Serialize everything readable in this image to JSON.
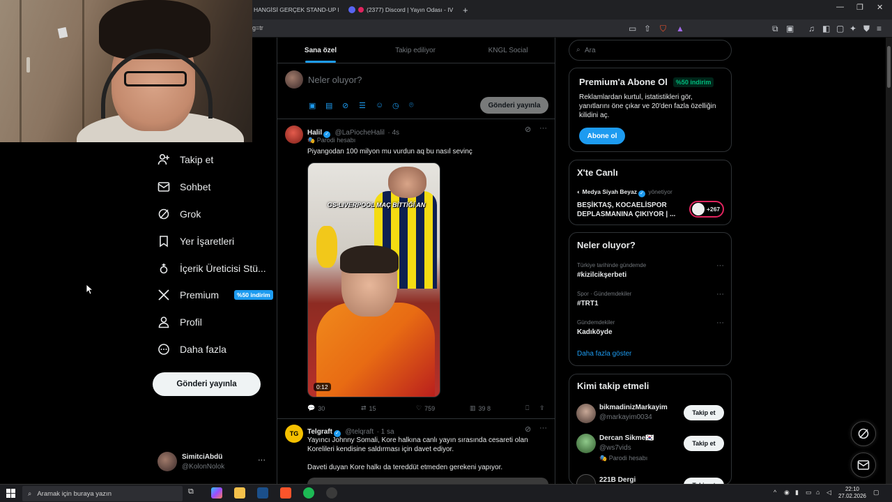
{
  "browser": {
    "tabs": [
      {
        "title": "HANGİSİ GERÇEK STAND-UP KOM"
      },
      {
        "title": "(2377) Discord | Yayın Odası - IV"
      }
    ],
    "new_tab": "+",
    "address": "g=tr",
    "window_buttons": [
      "—",
      "❐",
      "✕"
    ]
  },
  "nav": {
    "items": [
      {
        "label": "Takip et",
        "icon": "person-add-icon"
      },
      {
        "label": "Sohbet",
        "icon": "mail-icon"
      },
      {
        "label": "Grok",
        "icon": "grok-icon"
      },
      {
        "label": "Yer İşaretleri",
        "icon": "bookmark-icon"
      },
      {
        "label": "İçerik Üreticisi Stü...",
        "icon": "creator-studio-icon"
      },
      {
        "label": "Premium",
        "icon": "x-logo-icon",
        "badge": "%50 indirim"
      },
      {
        "label": "Profil",
        "icon": "profile-icon"
      },
      {
        "label": "Daha fazla",
        "icon": "more-circle-icon"
      }
    ],
    "post_button": "Gönderi yayınla",
    "account": {
      "name": "SimitciAbdü",
      "handle": "@KolonNolok",
      "more": "···"
    }
  },
  "feed": {
    "tabs": [
      "Sana özel",
      "Takip ediliyor",
      "KNGL Social"
    ],
    "compose_placeholder": "Neler oluyor?",
    "compose_button": "Gönderi yayınla",
    "tweets": [
      {
        "name": "Halil",
        "handle": "@LaPiocheHalil",
        "time": "· 4s",
        "sub": "Parodi hesabı",
        "text": "Piyangodan 100 milyon mu vurdun aq bu nasıl sevinç",
        "media_caption": "GS-LIVERPOOL MAÇ BİTTİĞİ AN",
        "duration": "0:12",
        "replies": "30",
        "reposts": "15",
        "likes": "759",
        "views": "39 8"
      },
      {
        "name": "Telgraft",
        "handle": "@telqraft",
        "time": "· 1 sa",
        "text1": "Yayıncı Johnny Somali, Kore halkına canlı yayın sırasında cesareti olan Korelileri kendisine saldırması için davet ediyor.",
        "text2": "Daveti duyan Kore halkı da tereddüt etmeden gerekeni yapıyor."
      }
    ]
  },
  "sidebar": {
    "search_placeholder": "Ara",
    "premium": {
      "title": "Premium'a Abone Ol",
      "badge": "%50 indirim",
      "text": "Reklamlardan kurtul, istatistikleri gör, yanıtlarını öne çıkar ve 20'den fazla özelliğin kilidini aç.",
      "button": "Abone ol"
    },
    "live": {
      "title": "X'te Canlı",
      "host": "Medya Siyah Beyaz",
      "role": "yönetiyor",
      "text": "BEŞİKTAŞ, KOCAELİSPOR DEPLASMANINA ÇIKIYOR | ...",
      "count": "+267"
    },
    "trends": {
      "title": "Neler oluyor?",
      "items": [
        {
          "meta": "Türkiye tarihinde gündemde",
          "name": "#kizilcikşerbeti"
        },
        {
          "meta": "Spor · Gündemdekiler",
          "name": "#TRT1"
        },
        {
          "meta": "Gündemdekiler",
          "name": "Kadıköyde"
        }
      ],
      "show_more": "Daha fazla göster"
    },
    "who_to_follow": {
      "title": "Kimi takip etmeli",
      "items": [
        {
          "name": "bikmadinizMarkayim",
          "handle": "@markayim0034",
          "button": "Takip et"
        },
        {
          "name": "Dercan Sikme🇰🇷",
          "handle": "@ws7vids",
          "sub": "Parodi hesabı",
          "button": "Takip et"
        },
        {
          "name": "221B Dergi",
          "button": "Takip et"
        }
      ]
    }
  },
  "taskbar": {
    "search_placeholder": "Aramak için buraya yazın",
    "time": "22:10",
    "date": "27.02.2026"
  },
  "colors": {
    "accent": "#1d9bf0",
    "bg": "#000000",
    "border": "#2f3336",
    "green": "#00ba7c"
  }
}
